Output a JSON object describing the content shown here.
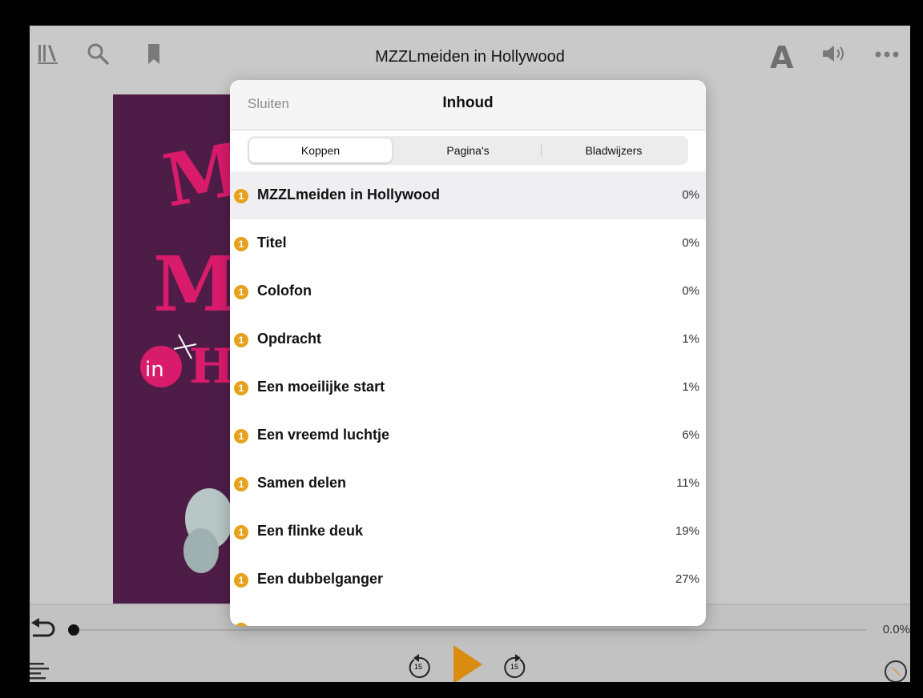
{
  "app": {
    "book_title": "MZZLmeiden in Hollywood",
    "font_button": "A",
    "progress_percent_label": "0.0%",
    "progress_fraction": 0.0,
    "skip_back_seconds": "15",
    "skip_forward_seconds": "15"
  },
  "modal": {
    "close_label": "Sluiten",
    "title": "Inhoud",
    "tabs": [
      {
        "label": "Koppen",
        "active": true
      },
      {
        "label": "Pagina's",
        "active": false
      },
      {
        "label": "Bladwijzers",
        "active": false
      }
    ],
    "badge_glyph": "1",
    "toc": [
      {
        "label": "MZZLmeiden in Hollywood",
        "percent": "0%",
        "selected": true
      },
      {
        "label": "Titel",
        "percent": "0%",
        "selected": false
      },
      {
        "label": "Colofon",
        "percent": "0%",
        "selected": false
      },
      {
        "label": "Opdracht",
        "percent": "1%",
        "selected": false
      },
      {
        "label": "Een moeilijke start",
        "percent": "1%",
        "selected": false
      },
      {
        "label": "Een vreemd luchtje",
        "percent": "6%",
        "selected": false
      },
      {
        "label": "Samen delen",
        "percent": "11%",
        "selected": false
      },
      {
        "label": "Een flinke deuk",
        "percent": "19%",
        "selected": false
      },
      {
        "label": "Een dubbelganger",
        "percent": "27%",
        "selected": false
      }
    ]
  },
  "colors": {
    "accent": "#e6a21c",
    "play_button": "#d98c10",
    "cover_background": "#4e1d47",
    "cover_title": "#d91b6b"
  },
  "icons": [
    "library-icon",
    "search-icon",
    "bookmark-icon",
    "font-size-icon",
    "speaker-icon",
    "more-icon",
    "undo-icon",
    "toc-list-icon",
    "skip-back-15-icon",
    "play-icon",
    "skip-forward-15-icon",
    "compass-icon"
  ]
}
